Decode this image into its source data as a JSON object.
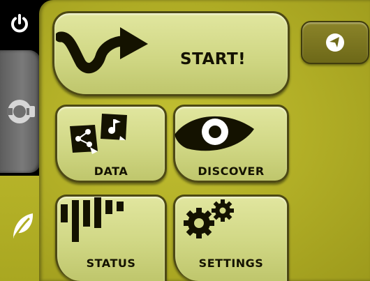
{
  "colors": {
    "panel": "#b1ae26",
    "button_face": "#d6dc8b",
    "button_border": "#4d4914",
    "nav_button": "#7c7620",
    "sidebar": "#000000",
    "inactive_tab": "#6a6a6a",
    "icon_dark": "#141200",
    "icon_light": "#ffffff"
  },
  "sidebar": {
    "items": [
      {
        "icon": "power-icon"
      },
      {
        "icon": "map-tab-icon",
        "state": "inactive"
      },
      {
        "icon": "leaf-icon",
        "state": "active"
      }
    ]
  },
  "menu": {
    "start": {
      "label": "START!",
      "icon": "route-arrow-icon"
    },
    "data": {
      "label": "DATA",
      "icon": "data-docs-icon"
    },
    "discover": {
      "label": "DISCOVER",
      "icon": "eye-icon"
    },
    "status": {
      "label": "STATUS",
      "icon": "signal-bars-icon"
    },
    "settings": {
      "label": "SETTINGS",
      "icon": "gears-icon"
    }
  },
  "nav_button": {
    "icon": "navigation-arrow-icon"
  }
}
